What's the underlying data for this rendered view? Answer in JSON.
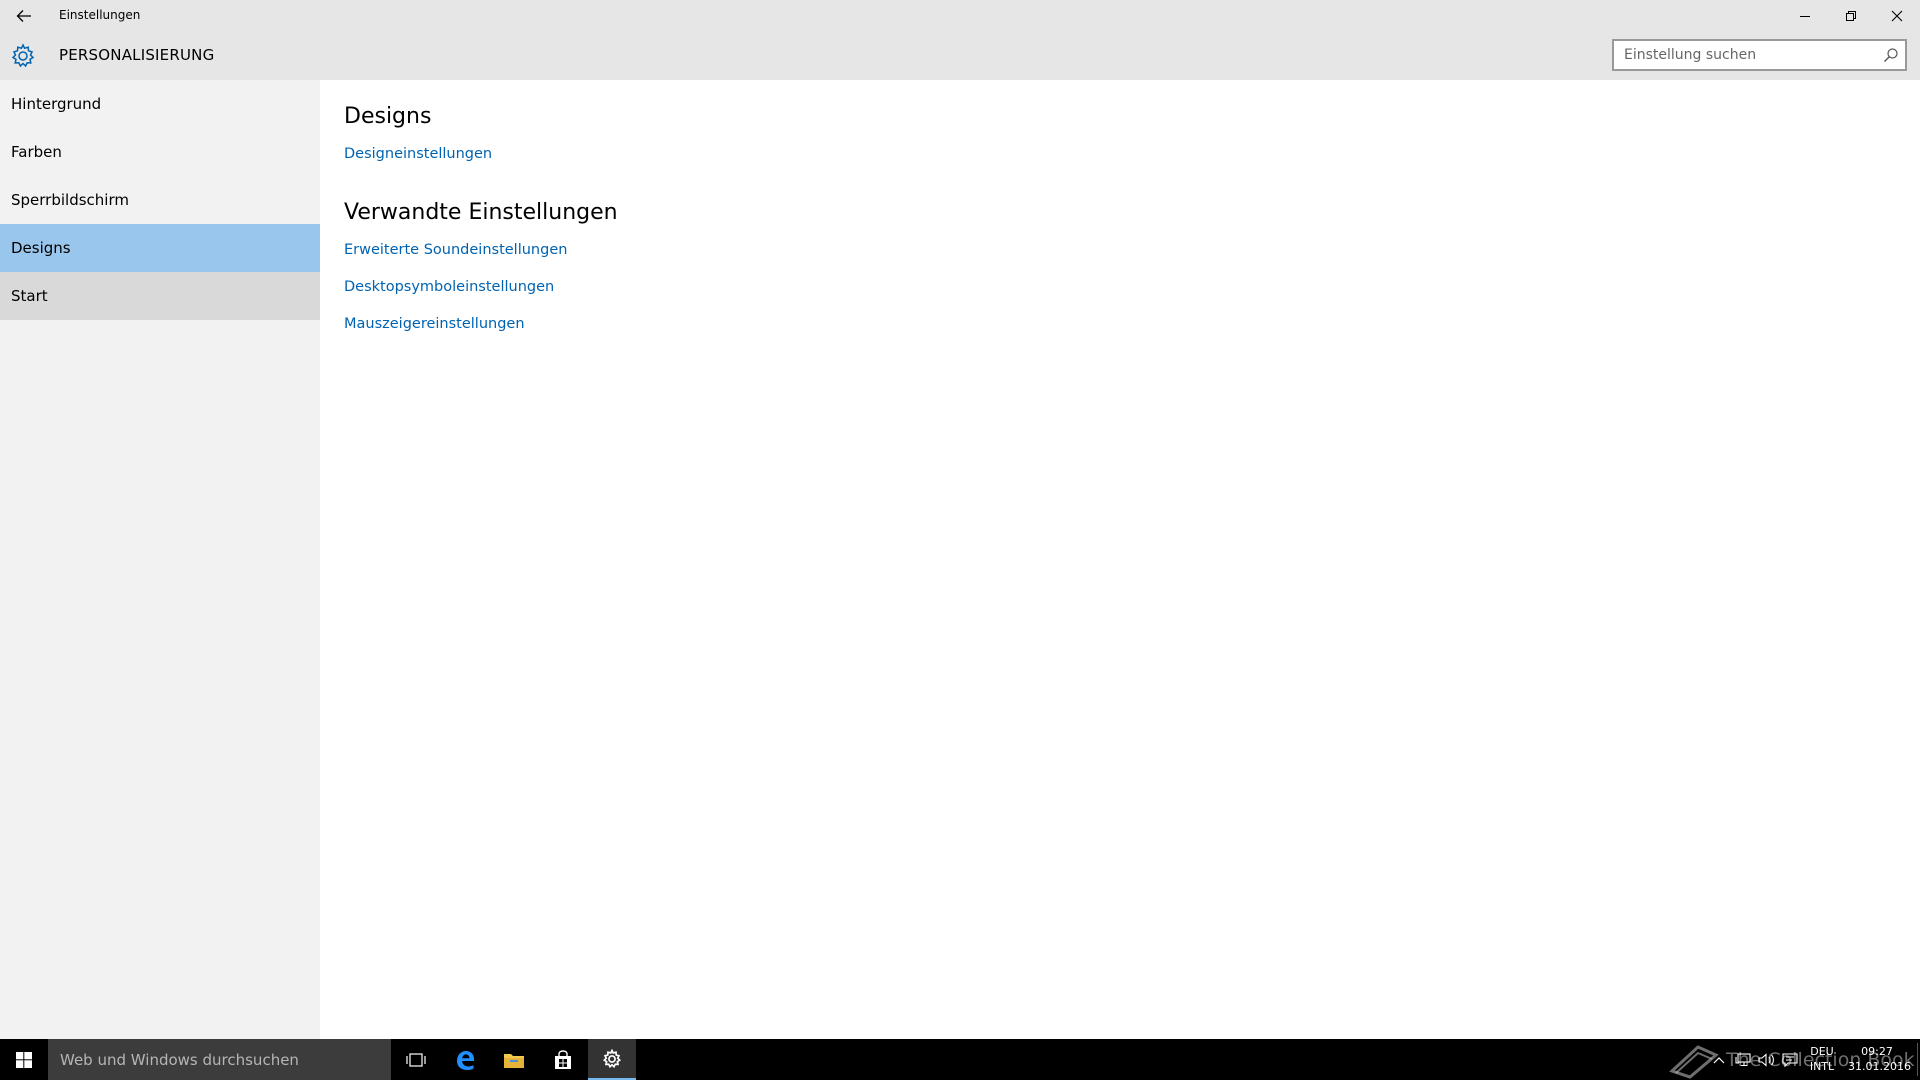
{
  "window": {
    "title": "Einstellungen"
  },
  "header": {
    "title": "PERSONALISIERUNG",
    "search_placeholder": "Einstellung suchen"
  },
  "sidebar": {
    "items": [
      {
        "label": "Hintergrund",
        "state": "normal"
      },
      {
        "label": "Farben",
        "state": "normal"
      },
      {
        "label": "Sperrbildschirm",
        "state": "normal"
      },
      {
        "label": "Designs",
        "state": "selected"
      },
      {
        "label": "Start",
        "state": "hover"
      }
    ]
  },
  "content": {
    "section_title": "Designs",
    "section_link": "Designeinstellungen",
    "related_title": "Verwandte Einstellungen",
    "related_links": [
      "Erweiterte Soundeinstellungen",
      "Desktopsymboleinstellungen",
      "Mauszeigereinstellungen"
    ]
  },
  "taskbar": {
    "search_placeholder": "Web und Windows durchsuchen",
    "language": {
      "line1": "DEU",
      "line2": "INTL"
    },
    "clock": {
      "time": "09:27",
      "date": "31.01.2016"
    },
    "watermark": "The Collection Book"
  },
  "colors": {
    "accent": "#0063b1",
    "selected_nav": "#99c6ec",
    "hover_nav": "#d9d9d9",
    "sidebar_bg": "#f2f2f2",
    "titlebar_bg": "#e6e6e6"
  }
}
